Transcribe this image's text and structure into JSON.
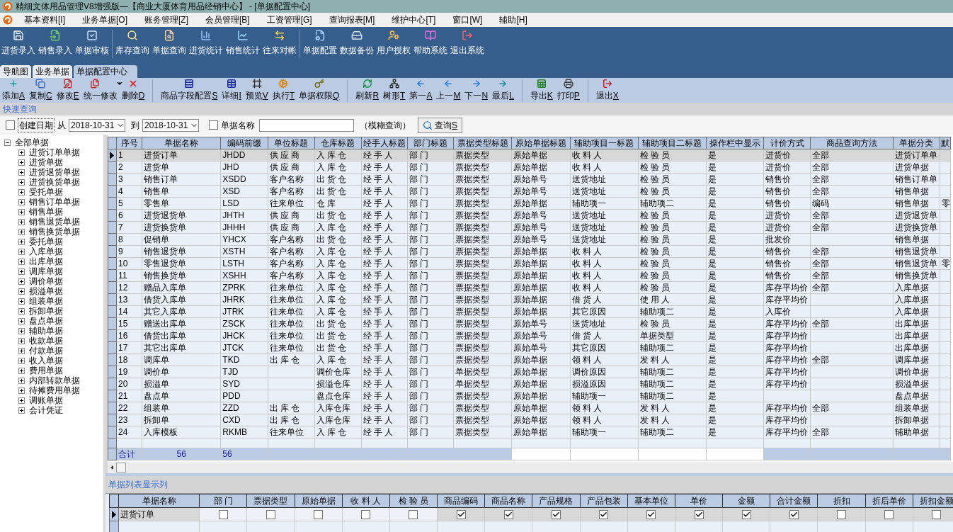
{
  "window": {
    "title": "精细文体用品管理V8增强版—【商业大厦体育用品经销中心】 - [单据配置中心]"
  },
  "menu": [
    "基本资料[I]",
    "业务单据[O]",
    "账务管理[Z]",
    "会员管理[B]",
    "工资管理[G]",
    "查询报表[M]",
    "维护中心[T]",
    "窗口[W]",
    "辅助[H]"
  ],
  "main_toolbar": [
    [
      "进货录入",
      "销售录入",
      "单据审核"
    ],
    [
      "库存查询",
      "单据查询",
      "进货统计",
      "销售统计",
      "往来对帐"
    ],
    [
      "单据配置",
      "数据备份",
      "用户授权",
      "帮助系统",
      "退出系统"
    ]
  ],
  "tabs": [
    {
      "label": "导航图",
      "selected": false
    },
    {
      "label": "业务单据",
      "selected": false
    },
    {
      "label": "单据配置中心",
      "selected": true
    }
  ],
  "doc_toolbar": [
    [
      {
        "label": "添加",
        "key": "A"
      },
      {
        "label": "复制",
        "key": "C"
      },
      {
        "label": "修改",
        "key": "E"
      },
      {
        "label": "统一修改",
        "kind": "dropdown"
      },
      {
        "label": "删除",
        "key": "D"
      }
    ],
    [
      {
        "label": "商品字段配置",
        "key": "S"
      },
      {
        "label": "详细",
        "key": "I"
      },
      {
        "label": "预览",
        "key": "V"
      },
      {
        "label": "执行",
        "key": "T"
      },
      {
        "label": "单据权限",
        "key": "Q"
      }
    ],
    [
      {
        "label": "刷新",
        "key": "R"
      },
      {
        "label": "树形",
        "key": "T"
      },
      {
        "label": "第一",
        "key": "A"
      },
      {
        "label": "上一",
        "key": "M"
      },
      {
        "label": "下一",
        "key": "N"
      },
      {
        "label": "最后",
        "key": "L"
      }
    ],
    [
      {
        "label": "导出",
        "key": "K"
      },
      {
        "label": "打印",
        "key": "P"
      }
    ],
    [
      {
        "label": "退出",
        "key": "X"
      }
    ]
  ],
  "quick_query": {
    "title": "快速查询",
    "date_checkbox": {
      "label": "创建日期",
      "checked": false
    },
    "from_label": "从",
    "date_from": "2018-10-31",
    "to_label": "到",
    "date_to": "2018-10-31",
    "name_checkbox": {
      "label": "单据名称",
      "checked": false
    },
    "hint": "（模糊查询）",
    "button": {
      "label": "查询",
      "key": "S"
    }
  },
  "tree": {
    "label": "全部单据",
    "expanded": true,
    "children": [
      {
        "label": "进货订单单据",
        "expanded": false
      },
      {
        "label": "进货单据",
        "expanded": false
      },
      {
        "label": "进货退货单据",
        "expanded": false
      },
      {
        "label": "进货换货单据",
        "expanded": false
      },
      {
        "label": "受托单据",
        "expanded": false
      },
      {
        "label": "销售订单单据",
        "expanded": false
      },
      {
        "label": "销售单据",
        "expanded": false
      },
      {
        "label": "销售退货单据",
        "expanded": false
      },
      {
        "label": "销售换货单据",
        "expanded": false
      },
      {
        "label": "委托单据",
        "expanded": false
      },
      {
        "label": "入库单据",
        "expanded": false
      },
      {
        "label": "出库单据",
        "expanded": false
      },
      {
        "label": "调库单据",
        "expanded": false
      },
      {
        "label": "调价单据",
        "expanded": false
      },
      {
        "label": "损溢单据",
        "expanded": false
      },
      {
        "label": "组装单据",
        "expanded": false
      },
      {
        "label": "拆卸单据",
        "expanded": false
      },
      {
        "label": "盘点单据",
        "expanded": false
      },
      {
        "label": "辅助单据",
        "expanded": false
      },
      {
        "label": "收款单据",
        "expanded": false
      },
      {
        "label": "付款单据",
        "expanded": false
      },
      {
        "label": "收入单据",
        "expanded": false
      },
      {
        "label": "费用单据",
        "expanded": false
      },
      {
        "label": "内部转款单据",
        "expanded": false
      },
      {
        "label": "待摊费用单据",
        "expanded": false
      },
      {
        "label": "调账单据",
        "expanded": false
      },
      {
        "label": "会计凭证",
        "expanded": false
      }
    ]
  },
  "table": {
    "columns": [
      "序号",
      "单据名称",
      "编码前缀",
      "单位标题",
      "仓库标题",
      "经手人标题",
      "部门标题",
      "票据类型标题",
      "原始单据标题",
      "辅助项目一标题",
      "辅助项目二标题",
      "操作栏中显示",
      "计价方式",
      "商品查询方法",
      "单据分类",
      "默"
    ],
    "rows": [
      {
        "selected": true,
        "cells": [
          "1",
          "进货订单",
          "JHDD",
          "供 应 商",
          "入 库 仓",
          "经 手 人",
          "部 门",
          "票据类型",
          "原始单据",
          "收 料 人",
          "检 验 员",
          "是",
          "进货价",
          "全部",
          "进货订单单",
          null
        ]
      },
      {
        "selected": false,
        "cells": [
          "2",
          "进货单",
          "JHD",
          "供 应 商",
          "入 库 仓",
          "经 手 人",
          "部 门",
          "票据类型",
          "原始单据",
          "收 料 人",
          "检 验 员",
          "是",
          "进货价",
          "全部",
          "进货单据",
          null
        ]
      },
      {
        "selected": false,
        "cells": [
          "3",
          "销售订单",
          "XSDD",
          "客户名称",
          "出 货 仓",
          "经 手 人",
          "部 门",
          "票据类型",
          "原始单号",
          "送货地址",
          "检 验 员",
          "是",
          "销售价",
          "全部",
          "销售订单单",
          null
        ]
      },
      {
        "selected": false,
        "cells": [
          "4",
          "销售单",
          "XSD",
          "客户名称",
          "出 货 仓",
          "经 手 人",
          "部 门",
          "票据类型",
          "原始单号",
          "送货地址",
          "检 验 员",
          "是",
          "销售价",
          "全部",
          "销售单据",
          null
        ]
      },
      {
        "selected": false,
        "cells": [
          "5",
          "零售单",
          "LSD",
          "往来单位",
          "仓 库",
          "经 手 人",
          "部 门",
          "票据类型",
          "原始单据",
          "辅助项一",
          "辅助项二",
          "是",
          "销售价",
          "编码",
          "销售单据",
          "零"
        ]
      },
      {
        "selected": false,
        "cells": [
          "6",
          "进货退货单",
          "JHTH",
          "供 应 商",
          "出 货 仓",
          "经 手 人",
          "部 门",
          "票据类型",
          "原始单号",
          "送货地址",
          "检 验 员",
          "是",
          "进货价",
          "全部",
          "进货退货单",
          null
        ]
      },
      {
        "selected": false,
        "cells": [
          "7",
          "进货换货单",
          "JHHH",
          "供 应 商",
          "入 库 仓",
          "经 手 人",
          "部 门",
          "票据类型",
          "原始单号",
          "送货地址",
          "检 验 员",
          "是",
          "进货价",
          "全部",
          "进货换货单",
          null
        ]
      },
      {
        "selected": false,
        "cells": [
          "8",
          "促销单",
          "YHCX",
          "客户名称",
          "出 货 仓",
          "经 手 人",
          "部 门",
          "票据类型",
          "原始单号",
          "送货地址",
          "检 验 员",
          "是",
          "批发价",
          null,
          "销售单据",
          null
        ]
      },
      {
        "selected": false,
        "cells": [
          "9",
          "销售退货单",
          "XSTH",
          "客户名称",
          "入 库 仓",
          "经 手 人",
          "部 门",
          "票据类型",
          "原始单据",
          "收 料 人",
          "检 验 员",
          "是",
          "销售价",
          "全部",
          "销售退货单",
          null
        ]
      },
      {
        "selected": false,
        "cells": [
          "10",
          "零售退货单",
          "LSTH",
          "客户名称",
          "入 库 仓",
          "经 手 人",
          "部 门",
          "票据类型",
          "原始单据",
          "收 料 人",
          "检 验 员",
          "是",
          "销售价",
          "全部",
          "销售退货单",
          "零"
        ]
      },
      {
        "selected": false,
        "cells": [
          "11",
          "销售换货单",
          "XSHH",
          "客户名称",
          "入 库 仓",
          "经 手 人",
          "部 门",
          "票据类型",
          "原始单据",
          "收 料 人",
          "检 验 员",
          "是",
          "销售价",
          "全部",
          "销售换货单",
          null
        ]
      },
      {
        "selected": false,
        "cells": [
          "12",
          "赠品入库单",
          "ZPRK",
          "往来单位",
          "入 库 仓",
          "经 手 人",
          "部 门",
          "票据类型",
          "原始单据",
          "收 料 人",
          "检 验 员",
          "是",
          "库存平均价",
          "全部",
          "入库单据",
          null
        ]
      },
      {
        "selected": false,
        "cells": [
          "13",
          "借货入库单",
          "JHRK",
          "往来单位",
          "入 库 仓",
          "经 手 人",
          "部 门",
          "票据类型",
          "原始单据",
          "借 货 人",
          "使 用 人",
          "是",
          "库存平均价",
          null,
          "入库单据",
          null
        ]
      },
      {
        "selected": false,
        "cells": [
          "14",
          "其它入库单",
          "JTRK",
          "往来单位",
          "入 库 仓",
          "经 手 人",
          "部 门",
          "票据类型",
          "原始单据",
          "其它原因",
          "辅助项二",
          "是",
          "入库价",
          null,
          "入库单据",
          null
        ]
      },
      {
        "selected": false,
        "cells": [
          "15",
          "赠送出库单",
          "ZSCK",
          "往来单位",
          "出 货 仓",
          "经 手 人",
          "部 门",
          "票据类型",
          "原始单号",
          "送货地址",
          "检 验 员",
          "是",
          "库存平均价",
          "全部",
          "出库单据",
          null
        ]
      },
      {
        "selected": false,
        "cells": [
          "16",
          "借货出库单",
          "JHCK",
          "往来单位",
          "出 货 仓",
          "经 手 人",
          "部 门",
          "票据类型",
          "原始单号",
          "借 货 人",
          "单据类型",
          "是",
          "库存平均价",
          null,
          "出库单据",
          null
        ]
      },
      {
        "selected": false,
        "cells": [
          "17",
          "其它出库单",
          "JTCK",
          "往来单位",
          "出 货 仓",
          "经 手 人",
          "部 门",
          "票据类型",
          "原始单号",
          "其它原因",
          "辅助项二",
          "是",
          "库存平均价",
          null,
          "出库单据",
          null
        ]
      },
      {
        "selected": false,
        "cells": [
          "18",
          "调库单",
          "TKD",
          "出 库 仓",
          "入 库 仓",
          "经 手 人",
          "部 门",
          "票据类型",
          "原始单据",
          "领 料 人",
          "发 料 人",
          "是",
          "库存平均价",
          "全部",
          "调库单据",
          null
        ]
      },
      {
        "selected": false,
        "cells": [
          "19",
          "调价单",
          "TJD",
          null,
          "调价仓库",
          "经 手 人",
          "部 门",
          "单据类型",
          "原始单据",
          "调价原因",
          "辅助项二",
          "是",
          "库存平均价",
          null,
          "调价单据",
          null
        ]
      },
      {
        "selected": false,
        "cells": [
          "20",
          "损溢单",
          "SYD",
          null,
          "损溢仓库",
          "经 手 人",
          "部 门",
          "单据类型",
          "原始单据",
          "损溢原因",
          "辅助项二",
          "是",
          "库存平均价",
          null,
          "损溢单据",
          null
        ]
      },
      {
        "selected": false,
        "cells": [
          "21",
          "盘点单",
          "PDD",
          null,
          "盘点仓库",
          "经 手 人",
          "部 门",
          "票据类型",
          "原始单据",
          "辅助项一",
          "辅助项二",
          "是",
          null,
          null,
          "盘点单据",
          null
        ]
      },
      {
        "selected": false,
        "cells": [
          "22",
          "组装单",
          "ZZD",
          "出 库 仓",
          "入库仓库",
          "经 手 人",
          "部 门",
          "票据类型",
          "原始单据",
          "领 料 人",
          "发 料 人",
          "是",
          "库存平均价",
          "全部",
          "组装单据",
          null
        ]
      },
      {
        "selected": false,
        "cells": [
          "23",
          "拆卸单",
          "CXD",
          "出 库 仓",
          "入库仓库",
          "经 手 人",
          "部 门",
          "票据类型",
          "原始单据",
          "领 料 人",
          "发 料 人",
          "是",
          "库存平均价",
          null,
          "拆卸单据",
          null
        ]
      },
      {
        "selected": false,
        "cells": [
          "24",
          "入库模板",
          "RKMB",
          "往来单位",
          "入 库 仓",
          "经 手 人",
          "部 门",
          "票据类型",
          "原始单据",
          "辅助项一",
          "辅助项二",
          "是",
          "库存平均价",
          "全部",
          "辅助单据",
          null
        ]
      }
    ],
    "totals": [
      "合计",
      "56",
      "56"
    ]
  },
  "display_columns": {
    "title": "单据列表显示列",
    "columns": [
      "单据名称",
      "部 门",
      "票据类型",
      "原始单据",
      "收 料 人",
      "检 验 员",
      "商品编码",
      "商品名称",
      "产品规格",
      "产品包装",
      "基本单位",
      "单价",
      "金额",
      "合计金额",
      "折扣",
      "折后单价",
      "折扣金额"
    ],
    "rows": [
      {
        "selected": true,
        "name": "进货订单",
        "checks": [
          false,
          false,
          false,
          false,
          false,
          true,
          true,
          true,
          true,
          true,
          true,
          true,
          true,
          false,
          false,
          false
        ]
      }
    ]
  }
}
